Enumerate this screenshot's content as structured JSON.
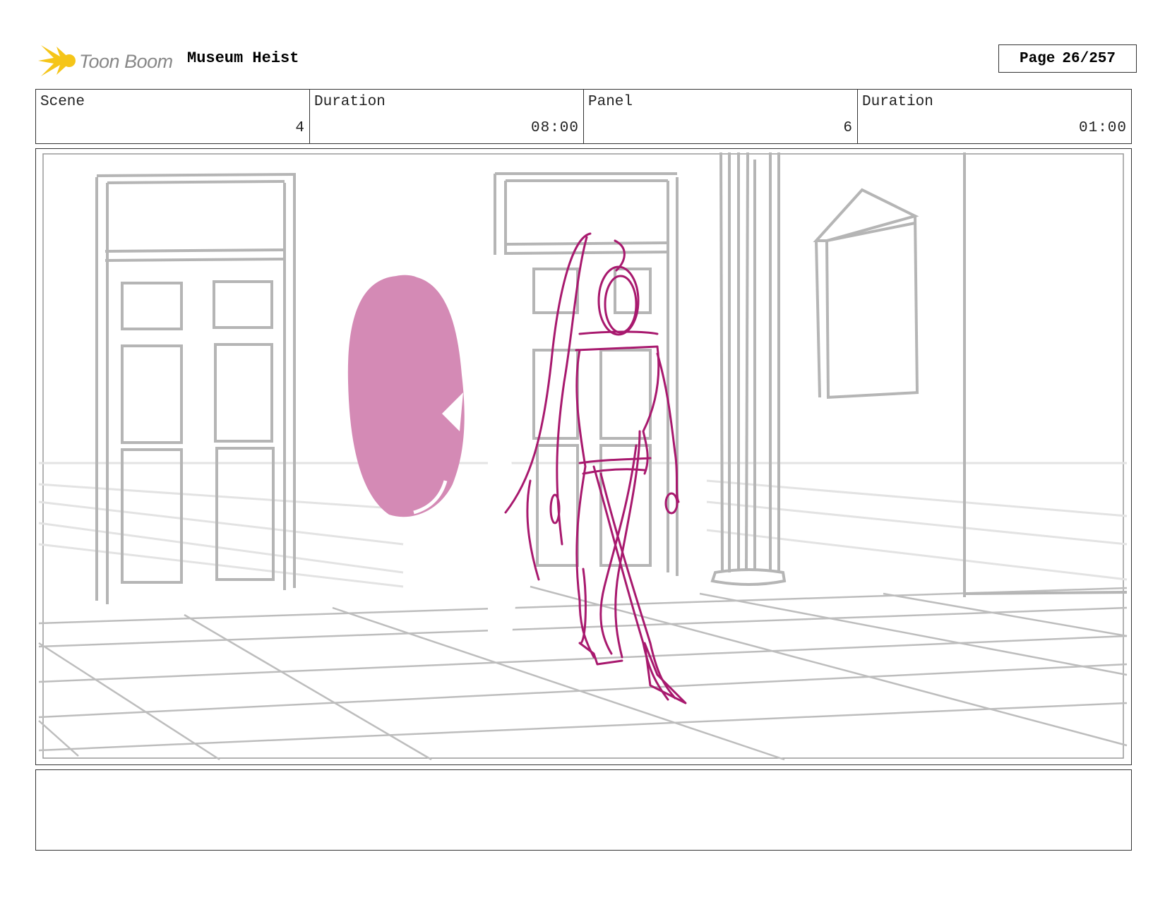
{
  "header": {
    "logo_text": "Toon Boom",
    "project_title": "Museum Heist",
    "page_label": "Page",
    "page_value": "26/257"
  },
  "info": [
    {
      "label": "Scene",
      "value": "4"
    },
    {
      "label": "Duration",
      "value": "08:00"
    },
    {
      "label": "Panel",
      "value": "6"
    },
    {
      "label": "Duration",
      "value": "01:00"
    }
  ],
  "panel": {
    "background_sketch_color": "#b5b5b5",
    "character_sketch_color": "#a8196e",
    "fill_color": "#d48ab5"
  },
  "notes": {
    "text": ""
  },
  "colors": {
    "logo_yellow": "#f5c518",
    "border": "#333333"
  }
}
